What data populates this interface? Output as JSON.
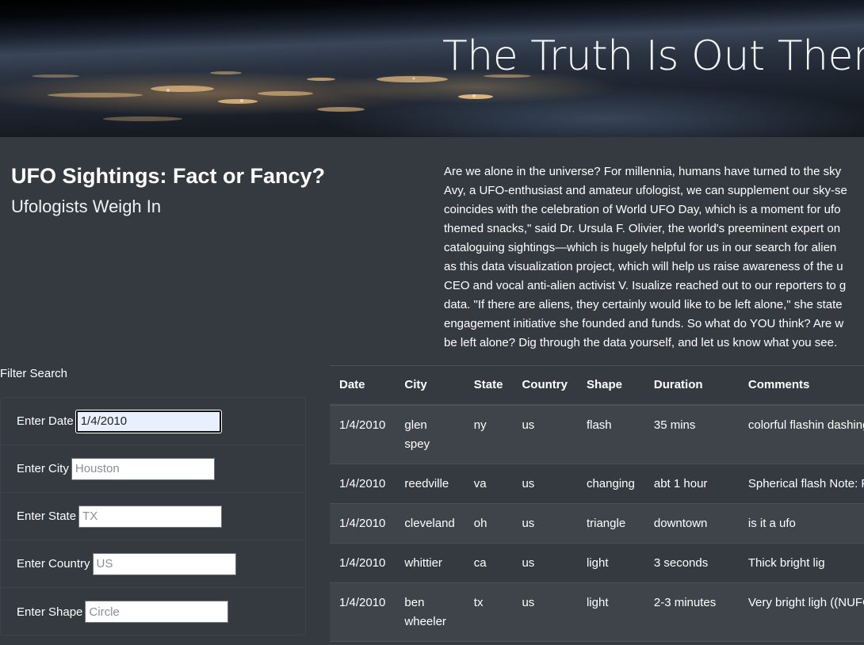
{
  "hero": {
    "title": "The Truth Is Out There"
  },
  "headline": {
    "title": "UFO Sightings: Fact or Fancy?",
    "subtitle": "Ufologists Weigh In"
  },
  "article": {
    "lines": [
      "Are we alone in the universe? For millennia, humans have turned to the sky",
      "Avy, a UFO-enthusiast and amateur ufologist, we can supplement our sky-se",
      "coincides with the celebration of World UFO Day, which is a moment for ufo",
      "themed snacks,\" said Dr. Ursula F. Olivier, the world's preeminent expert on",
      "cataloguing sightings—which is hugely helpful for us in our search for alien",
      "as this data visualization project, which will help us raise awareness of the u",
      "CEO and vocal anti-alien activist V. Isualize reached out to our reporters to g",
      "data. \"If there are aliens, they certainly would like to be left alone,\" she state",
      "engagement initiative she founded and funds. So what do YOU think? Are w",
      "be left alone? Dig through the data yourself, and let us know what you see."
    ]
  },
  "filters": {
    "title": "Filter Search",
    "date": {
      "label": "Enter Date",
      "value": "1/4/2010",
      "placeholder": ""
    },
    "city": {
      "label": "Enter City",
      "value": "",
      "placeholder": "Houston"
    },
    "state": {
      "label": "Enter State",
      "value": "",
      "placeholder": "TX"
    },
    "country": {
      "label": "Enter Country",
      "value": "",
      "placeholder": "US"
    },
    "shape": {
      "label": "Enter Shape",
      "value": "",
      "placeholder": "Circle"
    }
  },
  "table": {
    "headers": [
      "Date",
      "City",
      "State",
      "Country",
      "Shape",
      "Duration",
      "Comments"
    ],
    "rows": [
      [
        "1/4/2010",
        "glen spey",
        "ny",
        "us",
        "flash",
        "35 mins",
        "colorful flashin dashing to the"
      ],
      [
        "1/4/2010",
        "reedville",
        "va",
        "us",
        "changing",
        "abt 1 hour",
        "Spherical flash Note: Possible"
      ],
      [
        "1/4/2010",
        "cleveland",
        "oh",
        "us",
        "triangle",
        "downtown",
        "is it a ufo"
      ],
      [
        "1/4/2010",
        "whittier",
        "ca",
        "us",
        "light",
        "3 seconds",
        "Thick bright lig"
      ],
      [
        "1/4/2010",
        "ben wheeler",
        "tx",
        "us",
        "light",
        "2-3 minutes",
        "Very bright ligh ((NUFORC Not"
      ]
    ]
  }
}
